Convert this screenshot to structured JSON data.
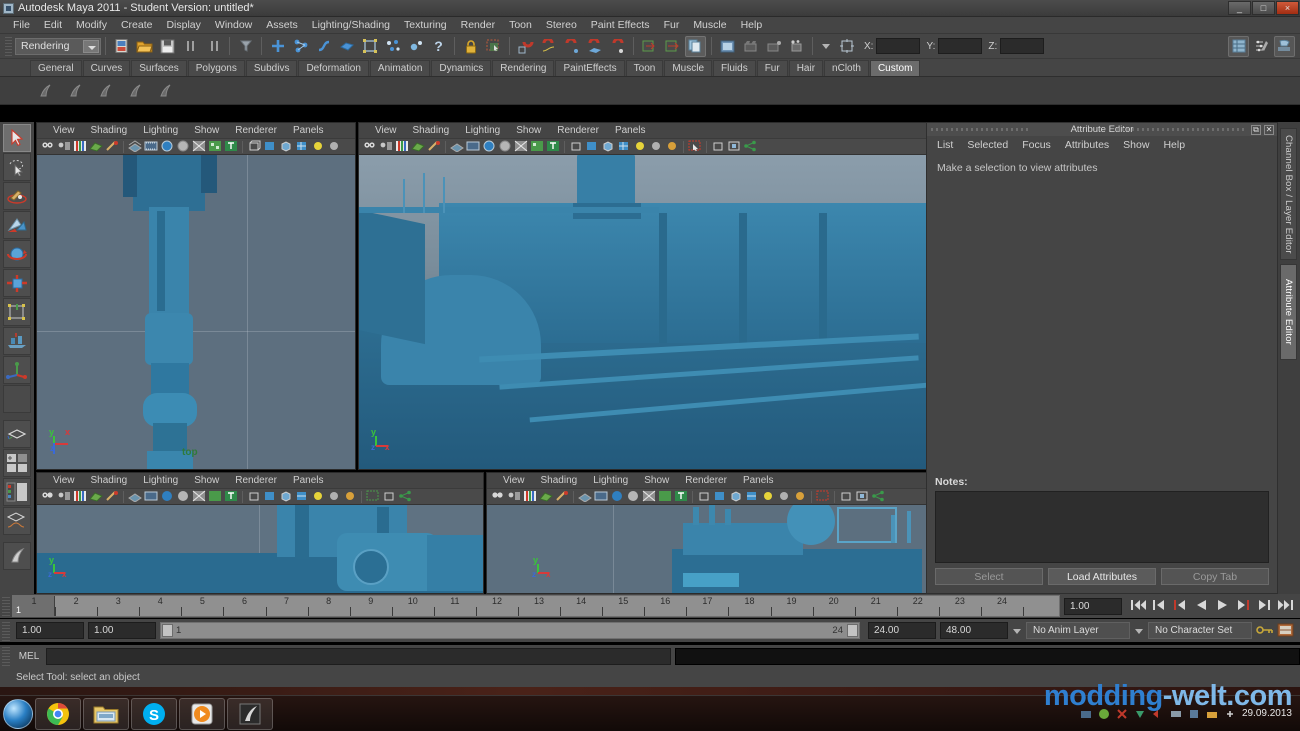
{
  "window": {
    "title": "Autodesk Maya 2011 - Student Version: untitled*",
    "minimize": "_",
    "maximize": "□",
    "close": "×"
  },
  "menubar": {
    "items": [
      "File",
      "Edit",
      "Modify",
      "Create",
      "Display",
      "Window",
      "Assets",
      "Lighting/Shading",
      "Texturing",
      "Render",
      "Toon",
      "Stereo",
      "Paint Effects",
      "Fur",
      "Muscle",
      "Help"
    ]
  },
  "statusline": {
    "menu_set": "Rendering",
    "x_label": "X:",
    "y_label": "Y:",
    "z_label": "Z:",
    "x_value": "",
    "y_value": "",
    "z_value": "",
    "icons": [
      "new-scene-icon",
      "open-scene-icon",
      "save-scene-icon",
      "undo-icon",
      "redo-icon",
      "select-by-hierarchy-icon",
      "select-by-object-icon",
      "select-by-component-icon",
      "hilite-icon",
      "poly-mask-icon",
      "nurbs-mask-icon",
      "deformer-mask-icon",
      "help-icon",
      "lock-icon",
      "render-region-icon",
      "snap-grid-icon",
      "snap-curve-icon",
      "snap-point-icon",
      "snap-view-plane-icon",
      "snap-magnet-icon",
      "input-connections-icon",
      "output-connections-icon",
      "construction-history-icon",
      "render-current-frame-icon",
      "ipr-render-icon",
      "render-settings-icon",
      "render-globals-icon",
      "hyper-shade-icon",
      "show-manipulator-icon"
    ],
    "right_icons": [
      "channel-box-toggle-icon",
      "attribute-editor-toggle-icon",
      "tool-settings-toggle-icon"
    ]
  },
  "shelf": {
    "tabs": [
      "General",
      "Curves",
      "Surfaces",
      "Polygons",
      "Subdivs",
      "Deformation",
      "Animation",
      "Dynamics",
      "Rendering",
      "PaintEffects",
      "Toon",
      "Muscle",
      "Fluids",
      "Fur",
      "Hair",
      "nCloth",
      "Custom"
    ],
    "active_tab": "Custom",
    "items": [
      "custom-script-1",
      "custom-script-2",
      "custom-script-3",
      "custom-script-4",
      "custom-script-5"
    ]
  },
  "toolbox": {
    "tools": [
      {
        "name": "select-tool",
        "active": true
      },
      {
        "name": "lasso-select-tool",
        "active": false
      },
      {
        "name": "paint-select-tool",
        "active": false
      },
      {
        "name": "move-tool",
        "active": false
      },
      {
        "name": "rotate-tool",
        "active": false
      },
      {
        "name": "scale-tool",
        "active": false
      },
      {
        "name": "universal-manipulator-tool",
        "active": false
      },
      {
        "name": "soft-modification-tool",
        "active": false
      },
      {
        "name": "show-manipulator-tool",
        "active": false
      },
      {
        "name": "last-tool-used",
        "active": false
      }
    ],
    "layouts": [
      "single-perspective-layout",
      "four-view-layout",
      "persp-outliner-layout",
      "hypergraph-layout",
      "paint-effects-layout"
    ]
  },
  "viewports": {
    "menus": [
      "View",
      "Shading",
      "Lighting",
      "Show",
      "Renderer",
      "Panels"
    ],
    "toolbar_icons": [
      "select-camera-icon",
      "lock-camera-icon",
      "bookmark-icon",
      "image-plane-icon",
      "two-d-pan-zoom-icon",
      "grid-toggle-icon",
      "film-gate-icon",
      "resolution-gate-icon",
      "gate-mask-icon",
      "film-origin-icon",
      "xray-icon",
      "texture-icon",
      "wireframe-icon",
      "smooth-shade-all-icon",
      "smooth-shade-flat-icon",
      "hardware-texturing-icon",
      "use-all-lights-icon",
      "shadows-icon",
      "ao-icon"
    ],
    "panels": [
      {
        "id": "top",
        "label": "top",
        "axes": {
          "y": "y",
          "x": "x",
          "z": "z"
        }
      },
      {
        "id": "persp",
        "label": "",
        "axes": {
          "y": "y",
          "x": "x",
          "z": "z"
        }
      },
      {
        "id": "front",
        "label": "",
        "axes": {
          "y": "y",
          "x": "x",
          "z": "z"
        }
      },
      {
        "id": "side",
        "label": "",
        "axes": {
          "y": "y",
          "x": "x",
          "z": "z"
        }
      }
    ]
  },
  "attribute_editor": {
    "panel_title": "Attribute Editor",
    "menus": [
      "List",
      "Selected",
      "Focus",
      "Attributes",
      "Show",
      "Help"
    ],
    "message": "Make a selection to view attributes",
    "notes_label": "Notes:",
    "notes_value": "",
    "buttons": [
      {
        "label": "Select",
        "enabled": false
      },
      {
        "label": "Load Attributes",
        "enabled": true
      },
      {
        "label": "Copy Tab",
        "enabled": false
      }
    ],
    "float_icon": "undock-icon",
    "close_icon": "close-icon"
  },
  "right_tabs": [
    {
      "label": "Channel Box / Layer Editor",
      "active": false
    },
    {
      "label": "Attribute Editor",
      "active": true
    }
  ],
  "timeline": {
    "ticks": [
      1,
      2,
      3,
      4,
      5,
      6,
      7,
      8,
      9,
      10,
      11,
      12,
      13,
      14,
      15,
      16,
      17,
      18,
      19,
      20,
      21,
      22,
      23,
      24
    ],
    "current_frame_label": "1",
    "current_frame_field": "1.00",
    "playback_buttons": [
      "go-to-start-icon",
      "step-back-frame-icon",
      "step-back-key-icon",
      "play-backwards-icon",
      "play-forwards-icon",
      "step-forward-key-icon",
      "step-forward-frame-icon",
      "go-to-end-icon"
    ]
  },
  "range": {
    "anim_start": "1.00",
    "range_start": "1.00",
    "slider_start_label": "1",
    "slider_end_label": "24",
    "range_end": "24.00",
    "anim_end": "48.00",
    "anim_layer": "No Anim Layer",
    "character_set": "No Character Set",
    "key_icon": "auto-key-icon",
    "prefs_icon": "animation-preferences-icon"
  },
  "command_line": {
    "label": "MEL",
    "value": "",
    "result": ""
  },
  "help_line": {
    "text": "Select Tool: select an object"
  },
  "taskbar": {
    "start": "start-orb-icon",
    "items": [
      "google-chrome-icon",
      "windows-explorer-icon",
      "skype-icon",
      "media-player-icon",
      "maya-icon"
    ],
    "tray_icons": [
      "tray-icon-1",
      "tray-icon-2",
      "tray-icon-3",
      "tray-icon-4",
      "tray-icon-5",
      "tray-icon-6",
      "tray-icon-7",
      "tray-icon-8",
      "tray-icon-9"
    ],
    "clock": "29.09.2013"
  },
  "watermark": {
    "part_a": "modding",
    "part_b": "-welt.com"
  },
  "colors": {
    "model_blue": "#2f7da8",
    "viewport_sky": "#6f8191",
    "chrome_gray": "#454545",
    "accent_green": "#2f7a3a",
    "watermark_blue": "#2f7fd0"
  }
}
